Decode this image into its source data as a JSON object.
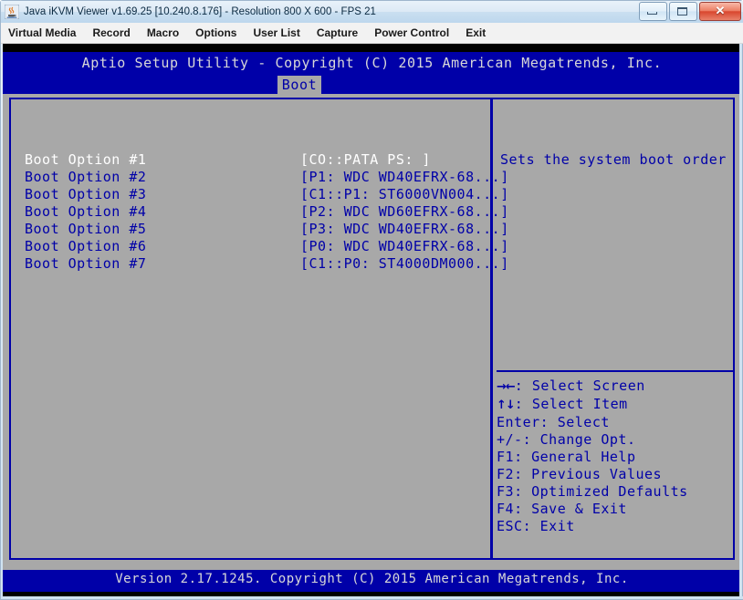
{
  "window": {
    "title": "Java iKVM Viewer v1.69.25 [10.240.8.176]  - Resolution 800 X 600 - FPS 21",
    "icon": "java-coffee-cup-icon",
    "controls": {
      "minimize_label": "",
      "maximize_label": "",
      "close_label": "✕"
    }
  },
  "menu": {
    "items": [
      {
        "label": "Virtual Media"
      },
      {
        "label": "Record"
      },
      {
        "label": "Macro"
      },
      {
        "label": "Options"
      },
      {
        "label": "User List"
      },
      {
        "label": "Capture"
      },
      {
        "label": "Power Control"
      },
      {
        "label": "Exit"
      }
    ]
  },
  "bios": {
    "title": "Aptio Setup Utility - Copyright (C) 2015 American Megatrends, Inc.",
    "active_tab": "Boot",
    "tabs": [
      {
        "label": "Boot",
        "active": true
      }
    ],
    "boot_options": [
      {
        "label": "Boot Option #1",
        "value": "[CO::PATA  PS: ]",
        "selected": true
      },
      {
        "label": "Boot Option #2",
        "value": "[P1: WDC WD40EFRX-68...]",
        "selected": false
      },
      {
        "label": "Boot Option #3",
        "value": "[C1::P1: ST6000VN004...]",
        "selected": false
      },
      {
        "label": "Boot Option #4",
        "value": "[P2: WDC WD60EFRX-68...]",
        "selected": false
      },
      {
        "label": "Boot Option #5",
        "value": "[P3: WDC WD40EFRX-68...]",
        "selected": false
      },
      {
        "label": "Boot Option #6",
        "value": "[P0: WDC WD40EFRX-68...]",
        "selected": false
      },
      {
        "label": "Boot Option #7",
        "value": "[C1::P0: ST4000DM000...]",
        "selected": false
      }
    ],
    "help_text": "Sets the system boot order",
    "key_legend": [
      {
        "keys": "→←",
        "sep": ": ",
        "action": "Select Screen",
        "is_arrow": true
      },
      {
        "keys": "↑↓",
        "sep": ": ",
        "action": "Select Item",
        "is_arrow": true
      },
      {
        "keys": "Enter",
        "sep": ": ",
        "action": "Select",
        "is_arrow": false
      },
      {
        "keys": "+/-",
        "sep": ": ",
        "action": "Change Opt.",
        "is_arrow": false
      },
      {
        "keys": "F1",
        "sep": ": ",
        "action": "General Help",
        "is_arrow": false
      },
      {
        "keys": "F2",
        "sep": ": ",
        "action": "Previous Values",
        "is_arrow": false
      },
      {
        "keys": "F3",
        "sep": ": ",
        "action": "Optimized Defaults",
        "is_arrow": false
      },
      {
        "keys": "F4",
        "sep": ": ",
        "action": "Save & Exit",
        "is_arrow": false
      },
      {
        "keys": "ESC",
        "sep": ": ",
        "action": "Exit",
        "is_arrow": false
      }
    ],
    "footer": "Version 2.17.1245. Copyright (C) 2015 American Megatrends, Inc."
  },
  "colors": {
    "bios_blue": "#0000a8",
    "bios_gray": "#a8a8a8",
    "bios_text_light": "#d8d8d8",
    "selected_white": "#ffffff",
    "title_bar": "#bdd7ed",
    "menu_bar": "#f2f2f2"
  }
}
